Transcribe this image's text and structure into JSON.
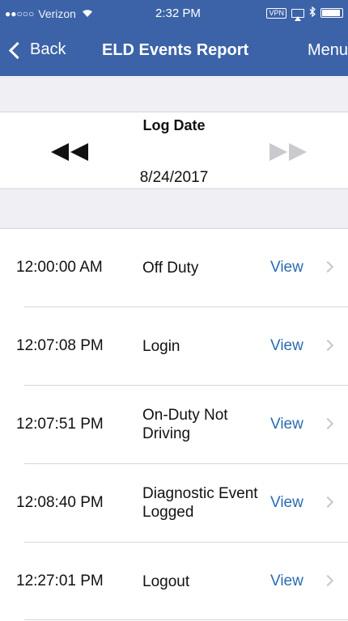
{
  "status": {
    "signal_dots": "●●○○○",
    "carrier": "Verizon",
    "time": "2:32 PM",
    "vpn": "VPN",
    "icons": [
      "wifi-icon",
      "airplay-icon",
      "bluetooth-icon",
      "battery-icon"
    ]
  },
  "nav": {
    "back_label": "Back",
    "title": "ELD Events Report",
    "menu_label": "Menu"
  },
  "log": {
    "label": "Log Date",
    "date": "8/24/2017",
    "prev_icon": "rewind-icon",
    "next_icon": "fast-forward-icon"
  },
  "events": [
    {
      "time": "12:00:00 AM",
      "event": "Off Duty",
      "action": "View"
    },
    {
      "time": "12:07:08 PM",
      "event": "Login",
      "action": "View"
    },
    {
      "time": "12:07:51 PM",
      "event": "On-Duty Not Driving",
      "action": "View"
    },
    {
      "time": "12:08:40 PM",
      "event": "Diagnostic Event Logged",
      "action": "View"
    },
    {
      "time": "12:27:01 PM",
      "event": "Logout",
      "action": "View"
    }
  ],
  "colors": {
    "nav_bg": "#3c63a8",
    "link": "#2a6cb0",
    "band": "#efeff4",
    "disabled": "#c9c9ce"
  }
}
